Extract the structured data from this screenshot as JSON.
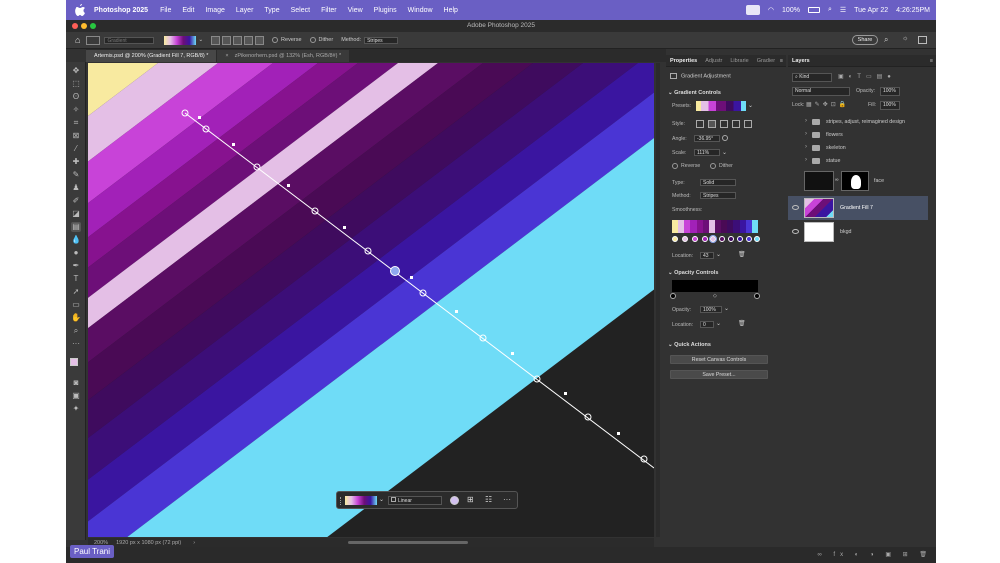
{
  "menubar": {
    "app_name": "Photoshop 2025",
    "items": [
      "File",
      "Edit",
      "Image",
      "Layer",
      "Type",
      "Select",
      "Filter",
      "View",
      "Plugins",
      "Window",
      "Help"
    ],
    "battery": "100%",
    "date": "Tue Apr 22",
    "time": "4:26:25PM"
  },
  "window": {
    "title": "Adobe Photoshop 2025"
  },
  "options_bar": {
    "tool_preset": "Gradient",
    "reverse_label": "Reverse",
    "dither_label": "Dither",
    "method_label": "Method:",
    "method_value": "Stripes",
    "share_label": "Share"
  },
  "doc_tabs": [
    {
      "label": "Artemis.psd @ 200% (Gradient Fill 7, RGB/8) *"
    },
    {
      "label": "zPikenorhern.psd @ 132% (Esh, RGB/8#) *"
    }
  ],
  "status": {
    "zoom": "200%",
    "doc_info": "1920 px x 1080 px (72 ppi)"
  },
  "overlay_toolbar": {
    "gradient_type": "Linear"
  },
  "watermark": "Paul Trani",
  "properties": {
    "tabs": [
      "Properties",
      "Adjustr",
      "Librarie",
      "Gradier"
    ],
    "header": "Gradient Adjustment",
    "gradient_controls_title": "Gradient Controls",
    "presets_label": "Presets:",
    "style_label": "Style:",
    "angle_label": "Angle:",
    "angle_value": "-36.95°",
    "scale_label": "Scale:",
    "scale_value": "111%",
    "reverse_label": "Reverse",
    "dither_label": "Dither",
    "type_label": "Type:",
    "type_value": "Solid",
    "method_label": "Method:",
    "method_value": "Stripes",
    "smoothness_label": "Smoothness:",
    "location_label": "Location:",
    "location_value": "43",
    "opacity_controls_title": "Opacity Controls",
    "opacity_label": "Opacity:",
    "opacity_value": "100%",
    "opacity_location_label": "Location:",
    "opacity_location_value": "0",
    "quick_actions_title": "Quick Actions",
    "reset_button": "Reset Canvas Controls",
    "save_preset_button": "Save Preset..."
  },
  "layers": {
    "tab": "Layers",
    "filter_kind": "Kind",
    "blend_mode": "Normal",
    "opacity_label": "Opacity:",
    "opacity_value": "100%",
    "lock_label": "Lock:",
    "fill_label": "Fill:",
    "fill_value": "100%",
    "items": [
      {
        "name": "stripes, adjust, reimagined design",
        "kind": "folder"
      },
      {
        "name": "flowers",
        "kind": "folder"
      },
      {
        "name": "skeleton",
        "kind": "folder"
      },
      {
        "name": "statue",
        "kind": "folder"
      },
      {
        "name": "face",
        "kind": "masked"
      },
      {
        "name": "Gradient Fill 7",
        "kind": "gradient"
      },
      {
        "name": "bkgd",
        "kind": "fill"
      }
    ]
  },
  "colors": {
    "stripes": [
      "#f8eaa0",
      "#e4bfe6",
      "#c843d8",
      "#a221b8",
      "#87128f",
      "#6d0f78",
      "#e4bfe6",
      "#5a0d63",
      "#4a0a55",
      "#3f0b5e",
      "#3c0e78",
      "#3a15a0",
      "#4a35d4",
      "#6fdcf7"
    ],
    "accent": "#6a5fc4"
  }
}
